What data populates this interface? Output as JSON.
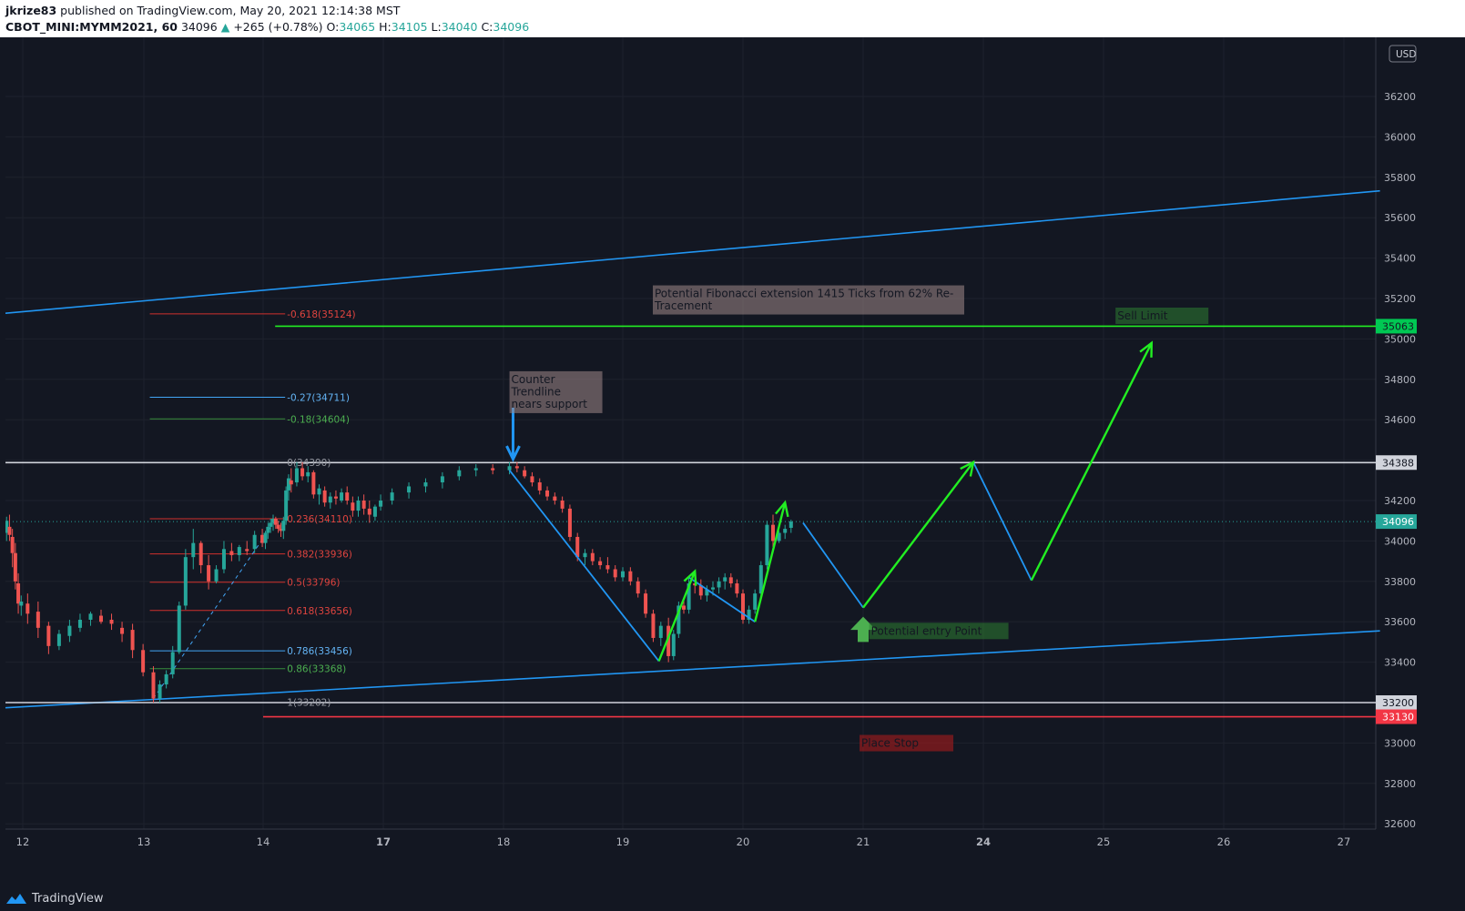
{
  "header": {
    "author": "jkrize83",
    "published_text": " published on TradingView.com, May 20, 2021 12:14:38 MST",
    "symbol": "CBOT_MINI:MYMM2021, 60",
    "last": "34096",
    "change": "+265 (+0.78%)",
    "o_label": "O:",
    "o_value": "34065",
    "h_label": "H:",
    "h_value": "34105",
    "l_label": "L:",
    "l_value": "34040",
    "c_label": "C:",
    "c_value": "34096"
  },
  "footer": {
    "brand": "TradingView"
  },
  "colors": {
    "background": "#131722",
    "grid": "#1e222d",
    "up": "#26a69a",
    "down": "#ef5350",
    "trendline": "#2196f3",
    "projection": "#22ee22",
    "fib_red": "#d0312d",
    "fib_blue": "#42a5f5",
    "fib_green": "#388e3c"
  },
  "chart_data": {
    "type": "candlestick",
    "currency": "USD",
    "x_ticks": [
      "12",
      "13",
      "14",
      "17",
      "18",
      "19",
      "20",
      "21",
      "24",
      "25",
      "26",
      "27"
    ],
    "bold_x_ticks": [
      "17",
      "24"
    ],
    "y_ticks": [
      36200,
      36000,
      35800,
      35600,
      35400,
      35200,
      35000,
      34800,
      34600,
      34400,
      34200,
      34000,
      33800,
      33600,
      33400,
      33200,
      33000,
      32800,
      32600
    ],
    "ylim": [
      32560,
      36460
    ],
    "price_labels": [
      {
        "value": "35063",
        "price": 35063,
        "kind": "green"
      },
      {
        "value": "34388",
        "price": 34388,
        "kind": "white"
      },
      {
        "value": "34096",
        "price": 34096,
        "kind": "teal"
      },
      {
        "value": "33200",
        "price": 33200,
        "kind": "white"
      },
      {
        "value": "33130",
        "price": 33130,
        "kind": "red"
      }
    ],
    "horizontal_lines": [
      {
        "price": 34388,
        "color": "#d1d4dc"
      },
      {
        "price": 33200,
        "color": "#d1d4dc"
      },
      {
        "price": 35063,
        "color": "#22ee22",
        "from_day": 14.3
      },
      {
        "price": 33130,
        "color": "#f23645",
        "from_day": 14.0
      }
    ],
    "fibonacci": [
      {
        "label": "-0.618(35124)",
        "price": 35124,
        "kind": "red"
      },
      {
        "label": "-0.27(34711)",
        "price": 34711,
        "kind": "blue"
      },
      {
        "label": "-0.18(34604)",
        "price": 34604,
        "kind": "green"
      },
      {
        "label": "0(34390)",
        "price": 34390,
        "kind": "gray"
      },
      {
        "label": "0.236(34110)",
        "price": 34110,
        "kind": "red"
      },
      {
        "label": "0.382(33936)",
        "price": 33936,
        "kind": "red"
      },
      {
        "label": "0.5(33796)",
        "price": 33796,
        "kind": "red"
      },
      {
        "label": "0.618(33656)",
        "price": 33656,
        "kind": "red"
      },
      {
        "label": "0.786(33456)",
        "price": 33456,
        "kind": "blue"
      },
      {
        "label": "0.86(33368)",
        "price": 33368,
        "kind": "green"
      },
      {
        "label": "1(33202)",
        "price": 33202,
        "kind": "gray"
      }
    ],
    "annotations": [
      {
        "text": "Potential Fibonacci extension 1415 Ticks from 62% Re-\nTracement",
        "kind": "gray"
      },
      {
        "text": "Counter\nTrendline\nnears support",
        "kind": "gray"
      },
      {
        "text": "Sell Limit",
        "kind": "green"
      },
      {
        "text": "Potential entry Point",
        "kind": "green"
      },
      {
        "text": "Place Stop",
        "kind": "red"
      }
    ],
    "channel_upper": [
      [
        11.0,
        35120
      ],
      [
        27.3,
        35733
      ]
    ],
    "channel_lower": [
      [
        11.0,
        33170
      ],
      [
        27.3,
        33555
      ]
    ],
    "blue_swings": [
      [
        [
          18.05,
          34350
        ],
        [
          19.3,
          33405
        ]
      ],
      [
        [
          19.55,
          33820
        ],
        [
          20.1,
          33600
        ]
      ],
      [
        [
          20.5,
          34090
        ],
        [
          21.0,
          33670
        ]
      ],
      [
        [
          23.75,
          34390
        ],
        [
          24.4,
          33805
        ]
      ]
    ],
    "green_projection": [
      [
        19.3,
        33405
      ],
      [
        19.6,
        33850
      ],
      [
        20.1,
        33600
      ],
      [
        20.35,
        34190
      ],
      [
        21.0,
        33670
      ],
      [
        23.75,
        34390
      ],
      [
        24.4,
        33805
      ],
      [
        25.4,
        34980
      ]
    ],
    "candles": [
      [
        34000,
        34060,
        33900,
        33920
      ],
      [
        34060,
        34130,
        33980,
        34020
      ],
      [
        34140,
        34180,
        34050,
        34100
      ],
      [
        34160,
        34170,
        34030,
        34060
      ],
      [
        34100,
        34150,
        34020,
        34110
      ],
      [
        34110,
        34140,
        34030,
        34050
      ],
      [
        34040,
        34120,
        34000,
        34100
      ],
      [
        34070,
        34130,
        34000,
        34030
      ],
      [
        34020,
        34060,
        33870,
        33940
      ],
      [
        33940,
        33990,
        33760,
        33800
      ],
      [
        33790,
        33840,
        33640,
        33690
      ],
      [
        33680,
        33730,
        33630,
        33700
      ],
      [
        33690,
        33740,
        33590,
        33640
      ],
      [
        33650,
        33700,
        33520,
        33570
      ],
      [
        33580,
        33600,
        33440,
        33480
      ],
      [
        33480,
        33560,
        33460,
        33540
      ],
      [
        33530,
        33610,
        33500,
        33580
      ],
      [
        33570,
        33640,
        33550,
        33610
      ],
      [
        33610,
        33650,
        33580,
        33640
      ],
      [
        33630,
        33660,
        33590,
        33600
      ],
      [
        33610,
        33640,
        33560,
        33590
      ],
      [
        33570,
        33600,
        33500,
        33540
      ],
      [
        33560,
        33590,
        33420,
        33460
      ],
      [
        33460,
        33490,
        33330,
        33350
      ],
      [
        33350,
        33380,
        33200,
        33220
      ],
      [
        33220,
        33310,
        33200,
        33290
      ],
      [
        33290,
        33360,
        33270,
        33340
      ],
      [
        33340,
        33480,
        33320,
        33450
      ],
      [
        33450,
        33700,
        33440,
        33680
      ],
      [
        33680,
        33960,
        33660,
        33920
      ],
      [
        33920,
        34060,
        33860,
        33990
      ],
      [
        33990,
        34000,
        33840,
        33880
      ],
      [
        33880,
        33930,
        33760,
        33800
      ],
      [
        33800,
        33880,
        33790,
        33860
      ],
      [
        33860,
        34000,
        33840,
        33960
      ],
      [
        33950,
        33990,
        33900,
        33930
      ],
      [
        33930,
        33980,
        33900,
        33970
      ],
      [
        33960,
        34000,
        33930,
        33950
      ],
      [
        33960,
        34050,
        33940,
        34030
      ],
      [
        34030,
        34060,
        33970,
        33990
      ],
      [
        33990,
        34050,
        33960,
        34040
      ],
      [
        34040,
        34090,
        34010,
        34070
      ],
      [
        34070,
        34110,
        34040,
        34090
      ],
      [
        34090,
        34130,
        34050,
        34110
      ],
      [
        34110,
        34120,
        34060,
        34080
      ],
      [
        34080,
        34100,
        34040,
        34060
      ],
      [
        34060,
        34090,
        34020,
        34050
      ],
      [
        34050,
        34120,
        34010,
        34100
      ],
      [
        34100,
        34270,
        34080,
        34250
      ],
      [
        34250,
        34330,
        34200,
        34310
      ],
      [
        34300,
        34360,
        34240,
        34280
      ],
      [
        34290,
        34390,
        34270,
        34360
      ],
      [
        34360,
        34390,
        34300,
        34320
      ],
      [
        34320,
        34370,
        34290,
        34340
      ],
      [
        34340,
        34350,
        34210,
        34230
      ],
      [
        34230,
        34280,
        34180,
        34260
      ],
      [
        34250,
        34270,
        34170,
        34190
      ],
      [
        34190,
        34240,
        34160,
        34220
      ],
      [
        34220,
        34250,
        34180,
        34210
      ],
      [
        34200,
        34260,
        34190,
        34240
      ],
      [
        34240,
        34270,
        34180,
        34200
      ],
      [
        34190,
        34220,
        34120,
        34150
      ],
      [
        34150,
        34220,
        34120,
        34200
      ],
      [
        34200,
        34230,
        34130,
        34160
      ],
      [
        34160,
        34200,
        34090,
        34130
      ],
      [
        34120,
        34180,
        34100,
        34170
      ],
      [
        34170,
        34230,
        34150,
        34200
      ],
      [
        34200,
        34260,
        34180,
        34240
      ],
      [
        34240,
        34290,
        34210,
        34270
      ],
      [
        34270,
        34310,
        34240,
        34290
      ],
      [
        34290,
        34340,
        34260,
        34320
      ],
      [
        34320,
        34370,
        34300,
        34350
      ],
      [
        34350,
        34380,
        34320,
        34360
      ],
      [
        34360,
        34380,
        34330,
        34350
      ],
      [
        34350,
        34390,
        34330,
        34370
      ],
      [
        34370,
        34390,
        34340,
        34360
      ],
      [
        34350,
        34370,
        34310,
        34320
      ],
      [
        34320,
        34340,
        34270,
        34290
      ],
      [
        34290,
        34310,
        34230,
        34250
      ],
      [
        34250,
        34270,
        34200,
        34220
      ],
      [
        34220,
        34240,
        34180,
        34200
      ],
      [
        34200,
        34220,
        34140,
        34160
      ],
      [
        34160,
        34180,
        34000,
        34020
      ],
      [
        34020,
        34040,
        33900,
        33920
      ],
      [
        33920,
        33960,
        33880,
        33940
      ],
      [
        33940,
        33960,
        33880,
        33900
      ],
      [
        33900,
        33920,
        33860,
        33880
      ],
      [
        33880,
        33920,
        33840,
        33860
      ],
      [
        33860,
        33880,
        33800,
        33820
      ],
      [
        33820,
        33870,
        33800,
        33850
      ],
      [
        33850,
        33870,
        33780,
        33800
      ],
      [
        33800,
        33820,
        33720,
        33740
      ],
      [
        33740,
        33760,
        33620,
        33640
      ],
      [
        33640,
        33660,
        33500,
        33520
      ],
      [
        33520,
        33600,
        33480,
        33580
      ],
      [
        33580,
        33620,
        33400,
        33430
      ],
      [
        33430,
        33560,
        33410,
        33540
      ],
      [
        33540,
        33700,
        33520,
        33680
      ],
      [
        33680,
        33720,
        33640,
        33660
      ],
      [
        33660,
        33820,
        33640,
        33790
      ],
      [
        33790,
        33850,
        33740,
        33780
      ],
      [
        33780,
        33810,
        33710,
        33730
      ],
      [
        33730,
        33780,
        33700,
        33760
      ],
      [
        33760,
        33800,
        33730,
        33770
      ],
      [
        33770,
        33820,
        33740,
        33800
      ],
      [
        33800,
        33840,
        33760,
        33820
      ],
      [
        33820,
        33840,
        33770,
        33790
      ],
      [
        33790,
        33810,
        33720,
        33740
      ],
      [
        33740,
        33760,
        33590,
        33610
      ],
      [
        33610,
        33680,
        33590,
        33660
      ],
      [
        33660,
        33760,
        33640,
        33740
      ],
      [
        33740,
        33900,
        33720,
        33880
      ],
      [
        33880,
        34100,
        33860,
        34080
      ],
      [
        34080,
        34130,
        33970,
        34000
      ],
      [
        34000,
        34050,
        33990,
        34040
      ],
      [
        34040,
        34080,
        34010,
        34060
      ],
      [
        34065,
        34105,
        34040,
        34096
      ]
    ],
    "candle_days": [
      11.0,
      13.08,
      13.35,
      14.7,
      18.05,
      19.38,
      19.55,
      20.55
    ],
    "candle_day_index": [
      0,
      24,
      29,
      50,
      74,
      95,
      99,
      119
    ]
  }
}
